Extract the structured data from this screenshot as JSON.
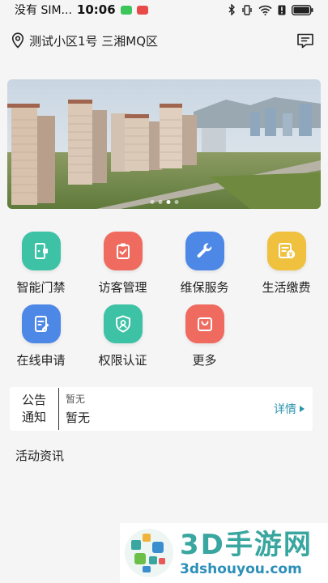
{
  "status_bar": {
    "carrier": "没有 SIM...",
    "time": "10:06",
    "battery_level": 0.9
  },
  "header": {
    "location": "测试小区1号 三湘MQ区"
  },
  "banner": {
    "image_icon": "residential-towers-photo",
    "page_count": 4,
    "active_page": 2
  },
  "services": [
    {
      "label": "智能门禁",
      "icon": "door-access-icon",
      "color": "#3dc2a6"
    },
    {
      "label": "访客管理",
      "icon": "visitor-badge-icon",
      "color": "#ef6b5f"
    },
    {
      "label": "维保服务",
      "icon": "wrench-icon",
      "color": "#4d88e6"
    },
    {
      "label": "生活缴费",
      "icon": "yuan-payment-icon",
      "color": "#f0c13f"
    },
    {
      "label": "在线申请",
      "icon": "edit-document-icon",
      "color": "#4d88e6"
    },
    {
      "label": "权限认证",
      "icon": "shield-user-icon",
      "color": "#3dc2a6"
    },
    {
      "label": "更多",
      "icon": "bag-icon",
      "color": "#ef6b5f"
    }
  ],
  "notice": {
    "title_line1": "公告",
    "title_line2": "通知",
    "subtitle": "暂无",
    "content": "暂无",
    "more_label": "详情"
  },
  "activity_section": {
    "title": "活动资讯"
  },
  "watermark": {
    "title": "3D手游网",
    "url": "3dshouyou.com"
  }
}
